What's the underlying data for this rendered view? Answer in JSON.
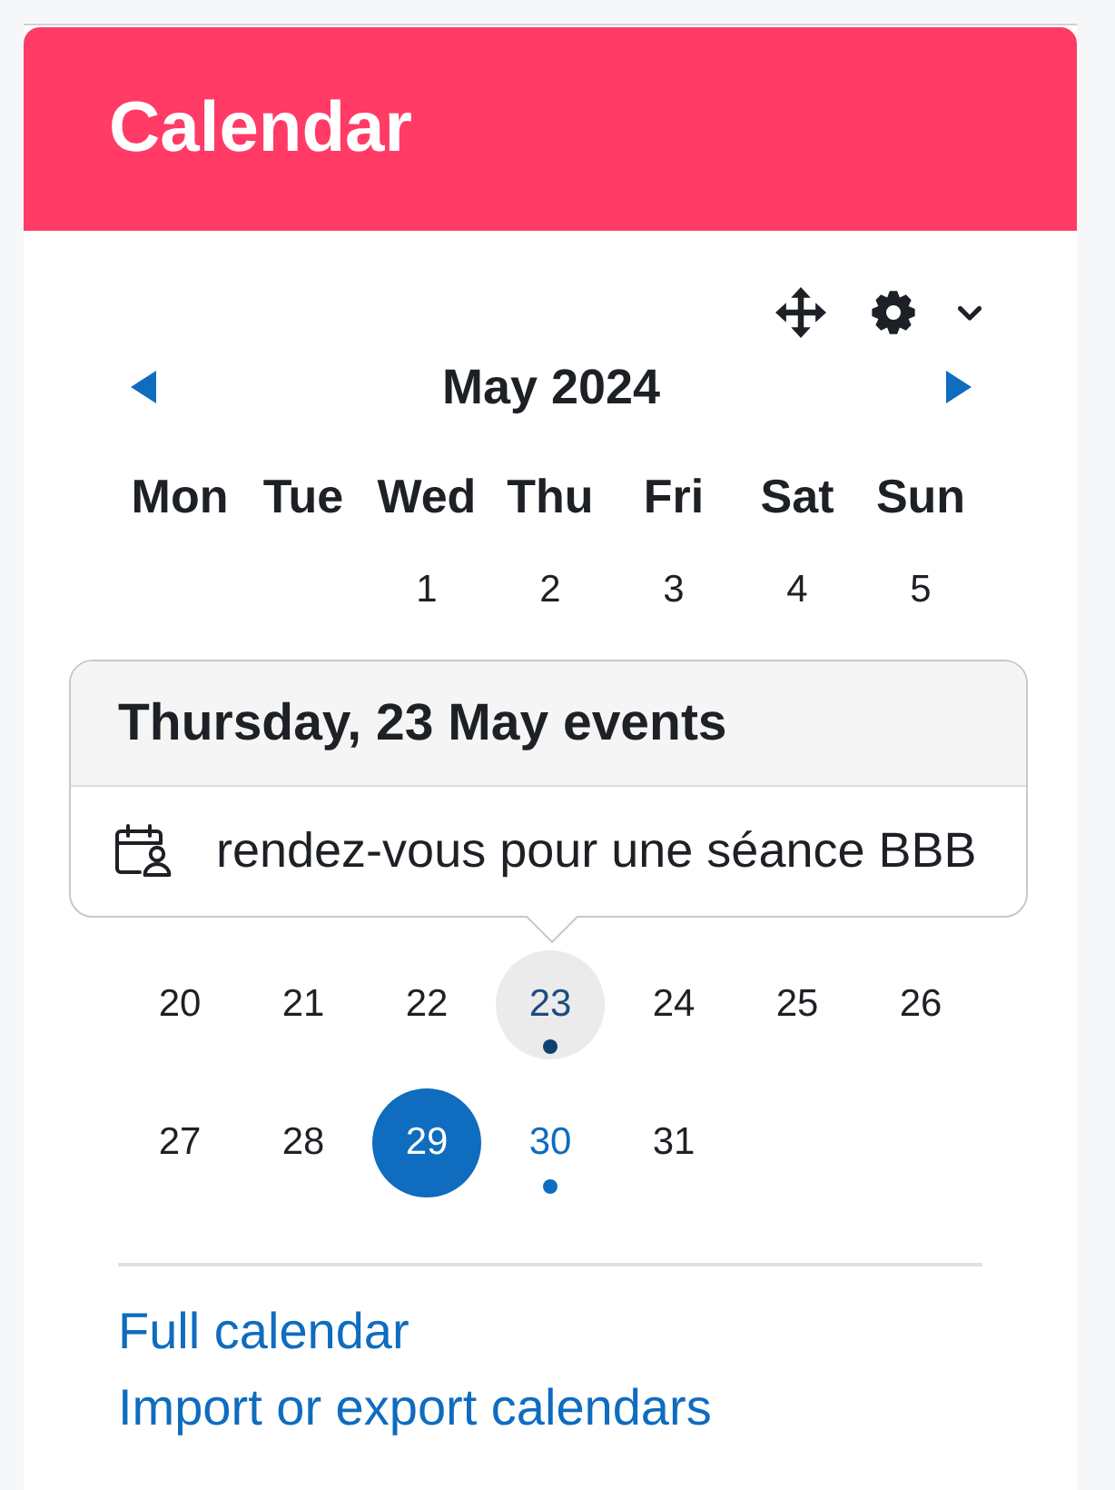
{
  "block": {
    "title": "Calendar"
  },
  "month": {
    "label": "May 2024"
  },
  "calendar": {
    "weekdays": [
      "Mon",
      "Tue",
      "Wed",
      "Thu",
      "Fri",
      "Sat",
      "Sun"
    ],
    "weeks": [
      {
        "days": [
          {
            "day": "1",
            "today": false,
            "highlighted": false,
            "has_events": false
          },
          {
            "day": "2",
            "today": false,
            "highlighted": false,
            "has_events": false
          },
          {
            "day": "3",
            "today": false,
            "highlighted": false,
            "has_events": false
          },
          {
            "day": "4",
            "today": false,
            "highlighted": false,
            "has_events": false
          },
          {
            "day": "5",
            "today": false,
            "highlighted": false,
            "has_events": false
          }
        ]
      },
      {
        "days": [
          {
            "day": "20",
            "today": false,
            "highlighted": false,
            "has_events": false
          },
          {
            "day": "21",
            "today": false,
            "highlighted": false,
            "has_events": false
          },
          {
            "day": "22",
            "today": false,
            "highlighted": false,
            "has_events": false
          },
          {
            "day": "23",
            "today": false,
            "highlighted": true,
            "has_events": true
          },
          {
            "day": "24",
            "today": false,
            "highlighted": false,
            "has_events": false
          },
          {
            "day": "25",
            "today": false,
            "highlighted": false,
            "has_events": false
          },
          {
            "day": "26",
            "today": false,
            "highlighted": false,
            "has_events": false
          }
        ]
      },
      {
        "days": [
          {
            "day": "27",
            "today": false,
            "highlighted": false,
            "has_events": false
          },
          {
            "day": "28",
            "today": false,
            "highlighted": false,
            "has_events": false
          },
          {
            "day": "29",
            "today": true,
            "highlighted": false,
            "has_events": false
          },
          {
            "day": "30",
            "today": false,
            "highlighted": false,
            "has_events": true
          },
          {
            "day": "31",
            "today": false,
            "highlighted": false,
            "has_events": false
          }
        ]
      }
    ],
    "popover": {
      "title": "Thursday, 23 May events",
      "events": [
        {
          "name": "rendez-vous pour une séance BBB"
        }
      ]
    }
  },
  "links": [
    "Full calendar",
    "Import or export calendars"
  ]
}
